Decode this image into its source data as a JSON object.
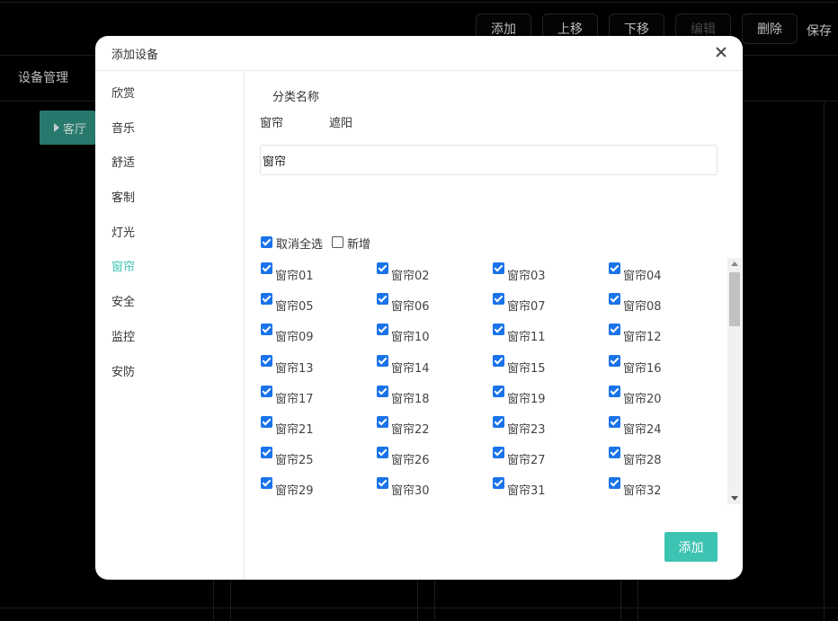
{
  "background": {
    "toolbar": [
      "添加",
      "上移",
      "下移",
      "编辑",
      "删除"
    ],
    "save_label": "保存",
    "side_title": "设备管理",
    "room_button": "客厅"
  },
  "modal": {
    "title": "添加设备",
    "categories": [
      "欣赏",
      "音乐",
      "舒适",
      "客制",
      "灯光",
      "窗帘",
      "安全",
      "监控",
      "安防"
    ],
    "active_category": "窗帘",
    "field_label": "分类名称",
    "name_options": [
      "窗帘",
      "遮阳"
    ],
    "name_input_value": "窗帘",
    "select_all_label": "取消全选",
    "new_label": "新增",
    "devices": [
      "窗帘01",
      "窗帘02",
      "窗帘03",
      "窗帘04",
      "窗帘05",
      "窗帘06",
      "窗帘07",
      "窗帘08",
      "窗帘09",
      "窗帘10",
      "窗帘11",
      "窗帘12",
      "窗帘13",
      "窗帘14",
      "窗帘15",
      "窗帘16",
      "窗帘17",
      "窗帘18",
      "窗帘19",
      "窗帘20",
      "窗帘21",
      "窗帘22",
      "窗帘23",
      "窗帘24",
      "窗帘25",
      "窗帘26",
      "窗帘27",
      "窗帘28",
      "窗帘29",
      "窗帘30",
      "窗帘31",
      "窗帘32"
    ],
    "add_button": "添加",
    "accent_color": "#3cc3b1",
    "checkbox_color": "#1a73e8"
  }
}
